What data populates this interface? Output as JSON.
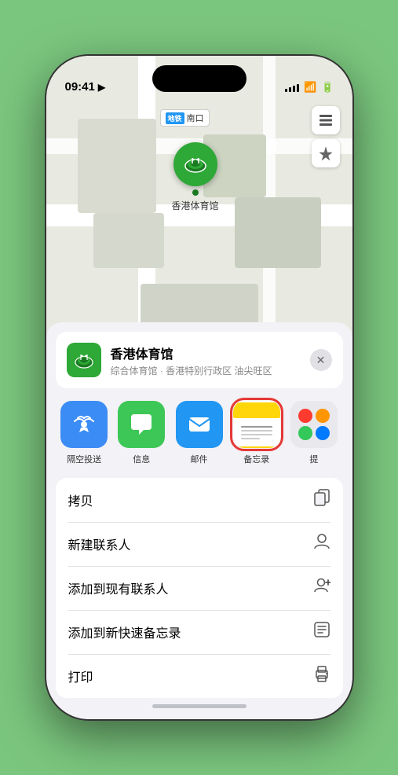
{
  "status": {
    "time": "09:41",
    "location_icon": "▶",
    "signal": [
      3,
      5,
      7,
      9,
      11
    ],
    "wifi": "wifi",
    "battery": "battery"
  },
  "map": {
    "south_gate_badge": "南口",
    "south_gate_badge_prefix": "地铁",
    "venue_name_pin": "香港体育馆",
    "map_btn_layers": "⊞",
    "map_btn_location": "➤"
  },
  "venue_card": {
    "name": "香港体育馆",
    "subtitle": "综合体育馆 · 香港特别行政区 油尖旺区",
    "close": "✕"
  },
  "share_items": [
    {
      "id": "airdrop",
      "label": "隔空投送",
      "type": "airdrop"
    },
    {
      "id": "messages",
      "label": "信息",
      "type": "messages"
    },
    {
      "id": "mail",
      "label": "邮件",
      "type": "mail"
    },
    {
      "id": "notes",
      "label": "备忘录",
      "type": "notes"
    },
    {
      "id": "more",
      "label": "提",
      "type": "more"
    }
  ],
  "actions": [
    {
      "label": "拷贝",
      "icon": "📋"
    },
    {
      "label": "新建联系人",
      "icon": "👤"
    },
    {
      "label": "添加到现有联系人",
      "icon": "👤"
    },
    {
      "label": "添加到新快速备忘录",
      "icon": "🗒"
    },
    {
      "label": "打印",
      "icon": "🖨"
    }
  ]
}
